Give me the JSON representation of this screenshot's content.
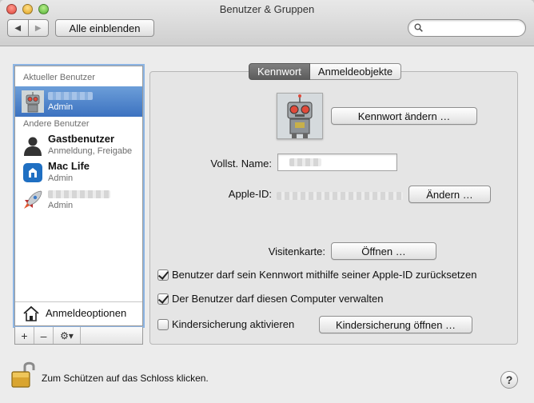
{
  "window": {
    "title": "Benutzer & Gruppen"
  },
  "toolbar": {
    "back_glyph": "◀",
    "forward_glyph": "▶",
    "show_all_label": "Alle einblenden",
    "search_placeholder": ""
  },
  "sidebar": {
    "current_header": "Aktueller Benutzer",
    "current_user": {
      "role": "Admin",
      "avatar_icon": "robot-avatar-icon"
    },
    "other_header": "Andere Benutzer",
    "others": [
      {
        "name": "Gastbenutzer",
        "role": "Anmeldung, Freigabe",
        "avatar_icon": "guest-silhouette-icon"
      },
      {
        "name": "Mac Life",
        "role": "Admin",
        "avatar_icon": "mac-life-logo-icon"
      },
      {
        "name": "",
        "role": "Admin",
        "avatar_icon": "rocket-icon"
      }
    ],
    "login_options_label": "Anmeldeoptionen",
    "add_glyph": "+",
    "remove_glyph": "–",
    "gear_glyph": "⚙▾"
  },
  "tabs": [
    {
      "label": "Kennwort",
      "active": true
    },
    {
      "label": "Anmeldeobjekte",
      "active": false
    }
  ],
  "password_tab": {
    "change_password_label": "Kennwort ändern …",
    "fullname_label": "Vollst. Name:",
    "apple_id_label": "Apple-ID:",
    "change_apple_id_label": "Ändern …",
    "contact_card_label": "Visitenkarte:",
    "open_card_label": "Öffnen …",
    "checkboxes": [
      {
        "label": "Benutzer darf sein Kennwort mithilfe seiner Apple-ID zurücksetzen",
        "checked": true
      },
      {
        "label": "Der Benutzer darf diesen Computer verwalten",
        "checked": true
      },
      {
        "label": "Kindersicherung aktivieren",
        "checked": false
      }
    ],
    "open_parental_label": "Kindersicherung öffnen …"
  },
  "footer": {
    "lock_text": "Zum Schützen auf das Schloss klicken.",
    "help_glyph": "?"
  },
  "colors": {
    "selection": "#3c72c0",
    "focus_ring": "#8db5e4",
    "active_tab": "#5c5c5c"
  }
}
